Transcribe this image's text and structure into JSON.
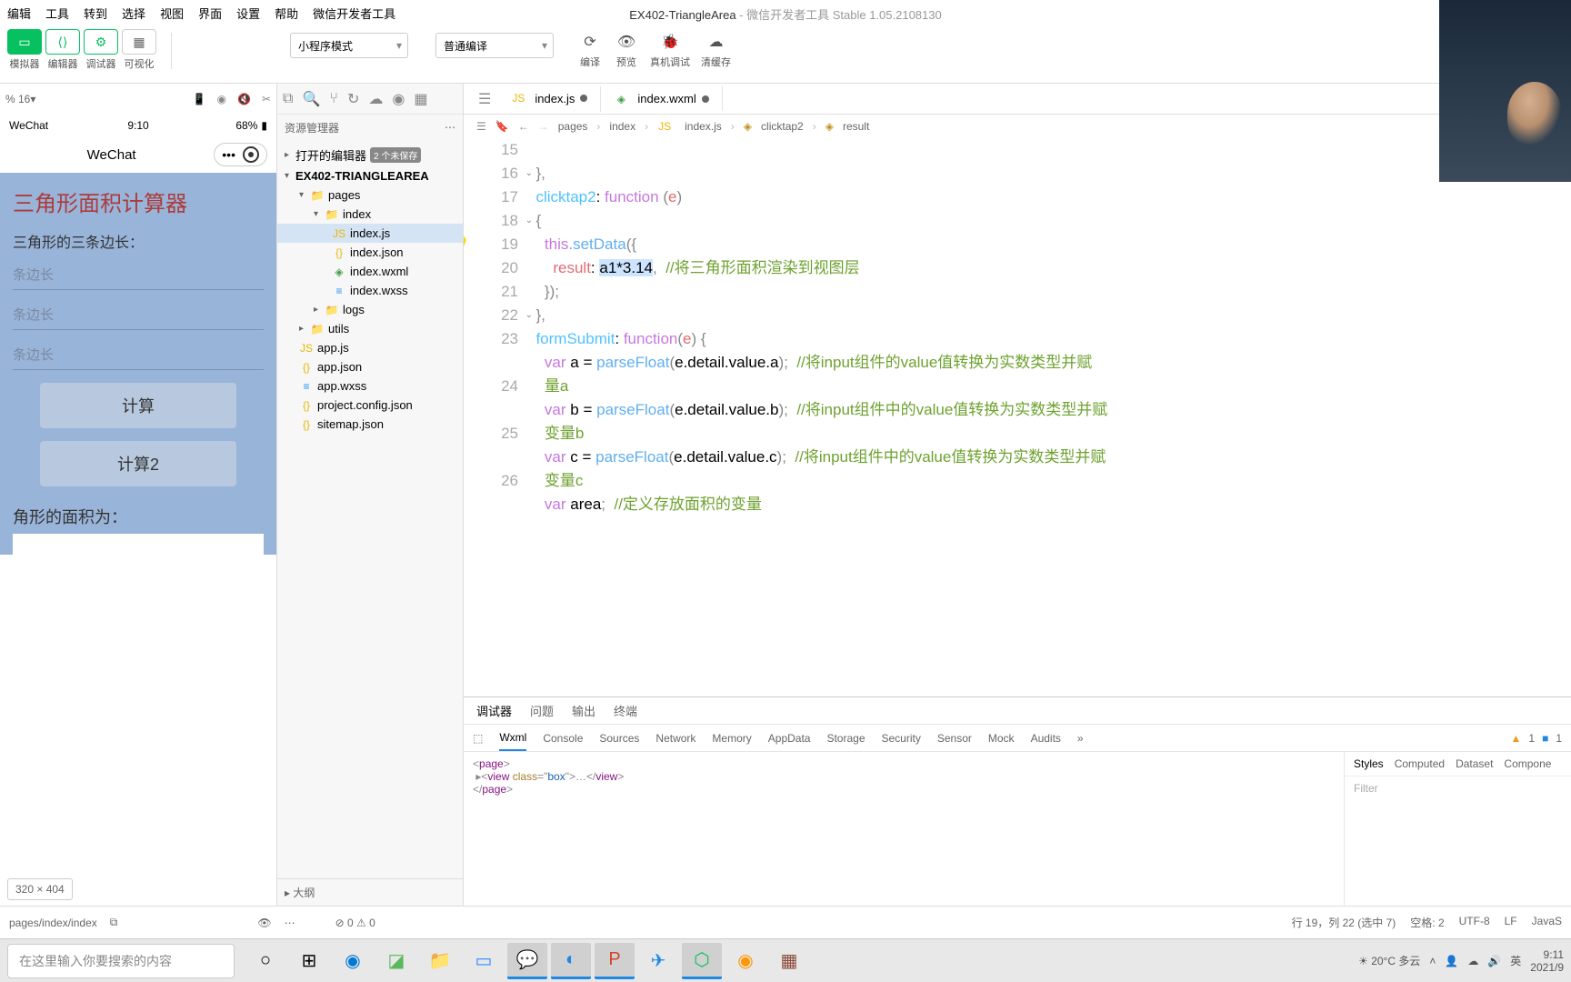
{
  "menu": {
    "items": [
      "编辑",
      "工具",
      "转到",
      "选择",
      "视图",
      "界面",
      "设置",
      "帮助",
      "微信开发者工具"
    ]
  },
  "window_title": {
    "project": "EX402-TriangleArea",
    "suffix": " - 微信开发者工具 Stable 1.05.2108130"
  },
  "toolbar": {
    "tabs": [
      "模拟器",
      "编辑器",
      "调试器",
      "可视化"
    ],
    "mode_dropdown": "小程序模式",
    "compile_dropdown": "普通编译",
    "actions": {
      "compile": "编译",
      "preview": "预览",
      "remote": "真机调试",
      "clear": "清缓存"
    }
  },
  "simulator": {
    "zoom": "% 16",
    "status": {
      "carrier": "WeChat",
      "time": "9:10",
      "battery": "68%"
    },
    "nav_title": "WeChat",
    "app": {
      "title": "三角形面积计算器",
      "label": "三角形的三条边长：",
      "placeholder": "条边长",
      "btn1": "计算",
      "btn2": "计算2",
      "result_label": "角形的面积为："
    },
    "dims": "320 × 404"
  },
  "explorer": {
    "header": "资源管理器",
    "opened_editors": "打开的编辑器",
    "unsaved_badge": "2 个未保存",
    "project": "EX402-TRIANGLEAREA",
    "tree": {
      "pages": "pages",
      "index": "index",
      "files": [
        "index.js",
        "index.json",
        "index.wxml",
        "index.wxss"
      ],
      "logs": "logs",
      "utils": "utils",
      "root_files": [
        "app.js",
        "app.json",
        "app.wxss",
        "project.config.json",
        "sitemap.json"
      ]
    },
    "outline": "大纲"
  },
  "editor": {
    "tabs": [
      {
        "name": "index.js",
        "icon": "js",
        "modified": true,
        "active": true
      },
      {
        "name": "index.wxml",
        "icon": "wxml",
        "modified": true,
        "active": false
      }
    ],
    "breadcrumb": [
      "pages",
      "index",
      "index.js",
      "clicktap2",
      "result"
    ],
    "line_numbers": [
      "15",
      "16",
      "17",
      "18",
      "19",
      "20",
      "21",
      "22",
      "23",
      "24",
      "25",
      "26"
    ],
    "code": {
      "l15": "},",
      "l16_name": "clicktap2",
      "l16_kw": "function",
      "l16_arg": "e",
      "l18_this": "this",
      "l18_fn": ".setData",
      "l19_prop": "result",
      "l19_sel": "a1*3.14",
      "l19_cmt": "//将三角形面积渲染到视图层",
      "l22_name": "formSubmit",
      "l22_kw": "function",
      "l22_arg": "e",
      "l23": {
        "kw": "var",
        "v": "a",
        "fn": "parseFloat",
        "arg": "e.detail.value.a",
        "cmt": "//将input组件的value值转换为实数类型并赋",
        "wrap": "量a"
      },
      "l24": {
        "kw": "var",
        "v": "b",
        "fn": "parseFloat",
        "arg": "e.detail.value.b",
        "cmt": "//将input组件中的value值转换为实数类型并赋",
        "wrap": "变量b"
      },
      "l25": {
        "kw": "var",
        "v": "c",
        "fn": "parseFloat",
        "arg": "e.detail.value.c",
        "cmt": "//将input组件中的value值转换为实数类型并赋",
        "wrap": "变量c"
      },
      "l26": {
        "kw": "var",
        "v": "area",
        "cmt": "//定义存放面积的变量"
      }
    }
  },
  "debugger": {
    "tabs1": [
      "调试器",
      "问题",
      "输出",
      "终端"
    ],
    "tabs2": [
      "Wxml",
      "Console",
      "Sources",
      "Network",
      "Memory",
      "AppData",
      "Storage",
      "Security",
      "Sensor",
      "Mock",
      "Audits"
    ],
    "warn_badge": "1",
    "err_badge": "1",
    "dom_page": "page",
    "dom_view_class": "box",
    "dom_view": "view",
    "styles_tabs": [
      "Styles",
      "Computed",
      "Dataset",
      "Compone"
    ],
    "filter": "Filter"
  },
  "statusbar": {
    "left_path": "pages/index/index",
    "errors": "0",
    "warnings": "0",
    "cursor": "行 19，列 22 (选中 7)",
    "spaces": "空格: 2",
    "encoding": "UTF-8",
    "eol": "LF",
    "lang": "JavaS"
  },
  "taskbar": {
    "search_placeholder": "在这里输入你要搜索的内容",
    "weather_temp": "20°C",
    "weather_desc": "多云",
    "ime": "英",
    "time": "9:11",
    "date": "2021/9"
  }
}
